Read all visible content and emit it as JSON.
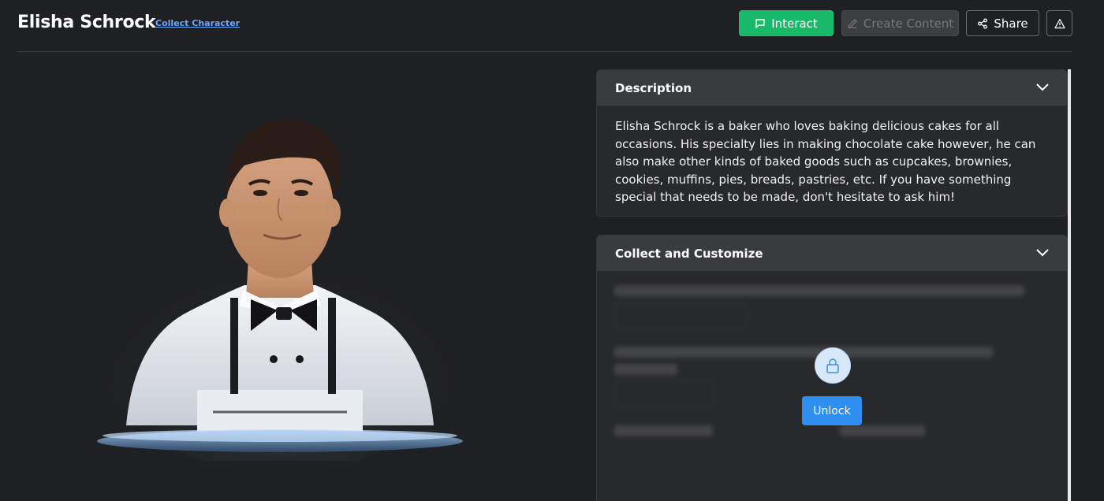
{
  "header": {
    "title": "Elisha Schrock",
    "collect_link": "Collect Character",
    "interact_label": "Interact",
    "create_content_label": "Create Content",
    "share_label": "Share"
  },
  "description": {
    "heading": "Description",
    "text": "Elisha Schrock is a baker who loves baking delicious cakes for all occasions. His specialty lies in making chocolate cake however, he can also make other kinds of baked goods such as cupcakes, brownies, cookies, muffins, pies, breads, pastries, etc. If you have something special that needs to be made, don't hesitate to ask him!"
  },
  "collect": {
    "heading": "Collect and Customize",
    "unlock_label": "Unlock"
  },
  "colors": {
    "background": "#1f2023",
    "interact": "#19b96a",
    "unlock": "#2e8ff0",
    "link": "#6aa7ff"
  },
  "icons": {
    "interact": "chat-bubble-icon",
    "create": "pencil-icon",
    "share": "share-icon",
    "report": "warning-icon",
    "collapse": "chevron-down-icon",
    "lock": "lock-icon"
  }
}
